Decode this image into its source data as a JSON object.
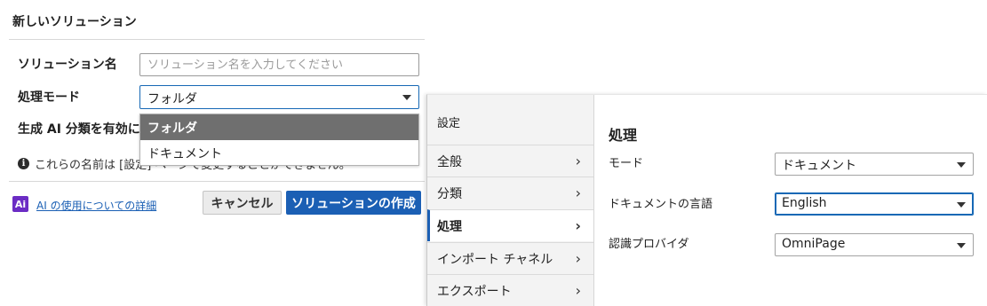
{
  "dialog": {
    "title": "新しいソリューション",
    "solution_name": {
      "label": "ソリューション名",
      "value": "",
      "placeholder": "ソリューション名を入力してください"
    },
    "processing_mode": {
      "label": "処理モード",
      "value": "フォルダ",
      "options": [
        "フォルダ",
        "ドキュメント"
      ]
    },
    "gen_ai_label": "生成 AI 分類を有効にす",
    "info_text": "これらの名前は [設定] ページで変更することができません。",
    "ai_badge": "Ai",
    "ai_link": "AI の使用についての詳細",
    "cancel_label": "キャンセル",
    "create_label": "ソリューションの作成"
  },
  "settings": {
    "header": "設定",
    "nav": [
      {
        "label": "全般"
      },
      {
        "label": "分類"
      },
      {
        "label": "処理"
      },
      {
        "label": "インポート チャネル"
      },
      {
        "label": "エクスポート"
      }
    ],
    "section_title": "処理",
    "fields": [
      {
        "label": "モード",
        "value": "ドキュメント"
      },
      {
        "label": "ドキュメントの言語",
        "value": "English"
      },
      {
        "label": "認識プロバイダ",
        "value": "OmniPage"
      }
    ]
  },
  "colors": {
    "primary_blue": "#1b5fb4",
    "selected_option_bg": "#6f6f6f",
    "ai_purple": "#6b2cc4"
  }
}
